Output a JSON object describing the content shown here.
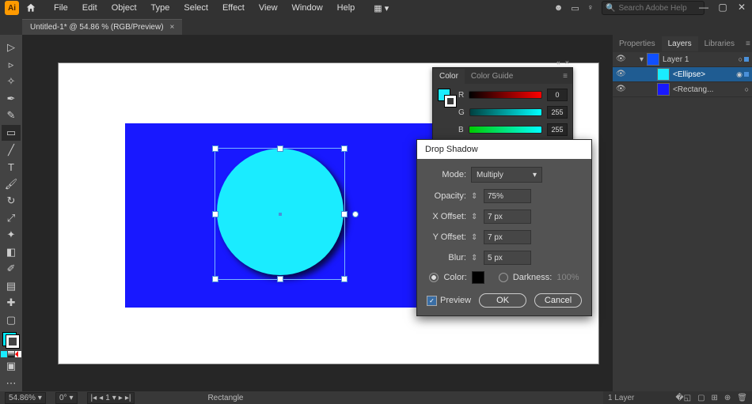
{
  "menu": {
    "items": [
      "File",
      "Edit",
      "Object",
      "Type",
      "Select",
      "Effect",
      "View",
      "Window",
      "Help"
    ]
  },
  "search": {
    "placeholder": "Search Adobe Help"
  },
  "doc": {
    "tab_title": "Untitled-1* @ 54.86 % (RGB/Preview)"
  },
  "layers_panel": {
    "tabs": [
      "Properties",
      "Layers",
      "Libraries"
    ],
    "rows": [
      {
        "name": "Layer 1"
      },
      {
        "name": "<Ellipse>"
      },
      {
        "name": "<Rectang..."
      }
    ],
    "footer": "1 Layer"
  },
  "color_panel": {
    "tabs": [
      "Color",
      "Color Guide"
    ],
    "r": "0",
    "g": "255",
    "b": "255"
  },
  "dialog": {
    "title": "Drop Shadow",
    "mode_label": "Mode:",
    "mode_value": "Multiply",
    "opacity_label": "Opacity:",
    "opacity_value": "75%",
    "xoff_label": "X Offset:",
    "xoff_value": "7 px",
    "yoff_label": "Y Offset:",
    "yoff_value": "7 px",
    "blur_label": "Blur:",
    "blur_value": "5 px",
    "color_label": "Color:",
    "darkness_label": "Darkness:",
    "darkness_value": "100%",
    "preview_label": "Preview",
    "ok": "OK",
    "cancel": "Cancel"
  },
  "status": {
    "zoom": "54.86%",
    "rotate": "0°",
    "artboard": "1",
    "tool": "Rectangle"
  }
}
